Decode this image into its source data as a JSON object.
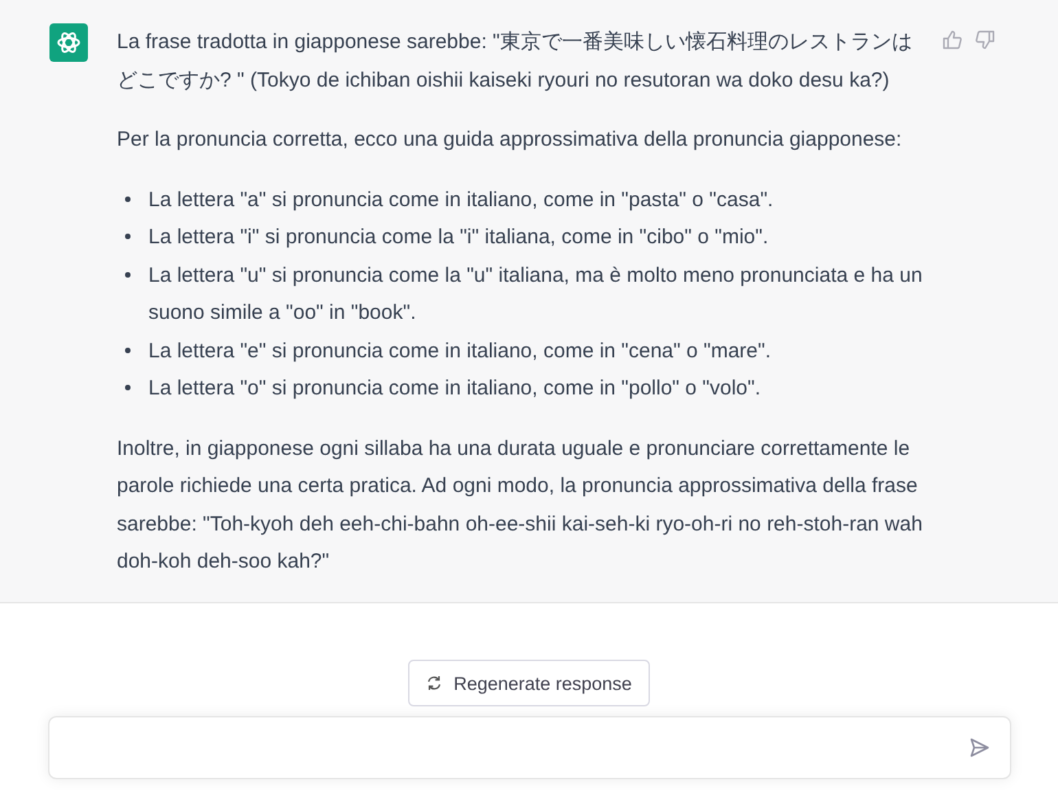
{
  "message": {
    "blocks": [
      {
        "kind": "paragraph",
        "text": "La frase tradotta in giapponese sarebbe: \"東京で一番美味しい懐石料理のレストランはどこですか?  \" (Tokyo de ichiban oishii kaiseki ryouri no resutoran wa doko desu ka?)"
      },
      {
        "kind": "paragraph",
        "text": "Per la pronuncia corretta, ecco una guida approssimativa della pronuncia giapponese:"
      },
      {
        "kind": "list",
        "items": [
          "La lettera \"a\" si pronuncia come in italiano, come in \"pasta\" o \"casa\".",
          "La lettera \"i\" si pronuncia come la \"i\" italiana, come in \"cibo\" o \"mio\".",
          "La lettera \"u\" si pronuncia come la \"u\" italiana, ma è molto meno pronunciata e ha un suono simile a \"oo\" in \"book\".",
          "La lettera \"e\" si pronuncia come in italiano, come in \"cena\" o \"mare\".",
          "La lettera \"o\" si pronuncia come in italiano, come in \"pollo\" o \"volo\"."
        ]
      },
      {
        "kind": "paragraph",
        "text": "Inoltre, in giapponese ogni sillaba ha una durata uguale e pronunciare correttamente le parole richiede una certa pratica. Ad ogni modo, la pronuncia approssimativa della frase sarebbe: \"Toh-kyoh deh eeh-chi-bahn oh-ee-shii kai-seh-ki ryo-oh-ri no reh-stoh-ran wah doh-koh deh-soo kah?\""
      }
    ]
  },
  "regenerate_button": {
    "label": "Regenerate response"
  }
}
